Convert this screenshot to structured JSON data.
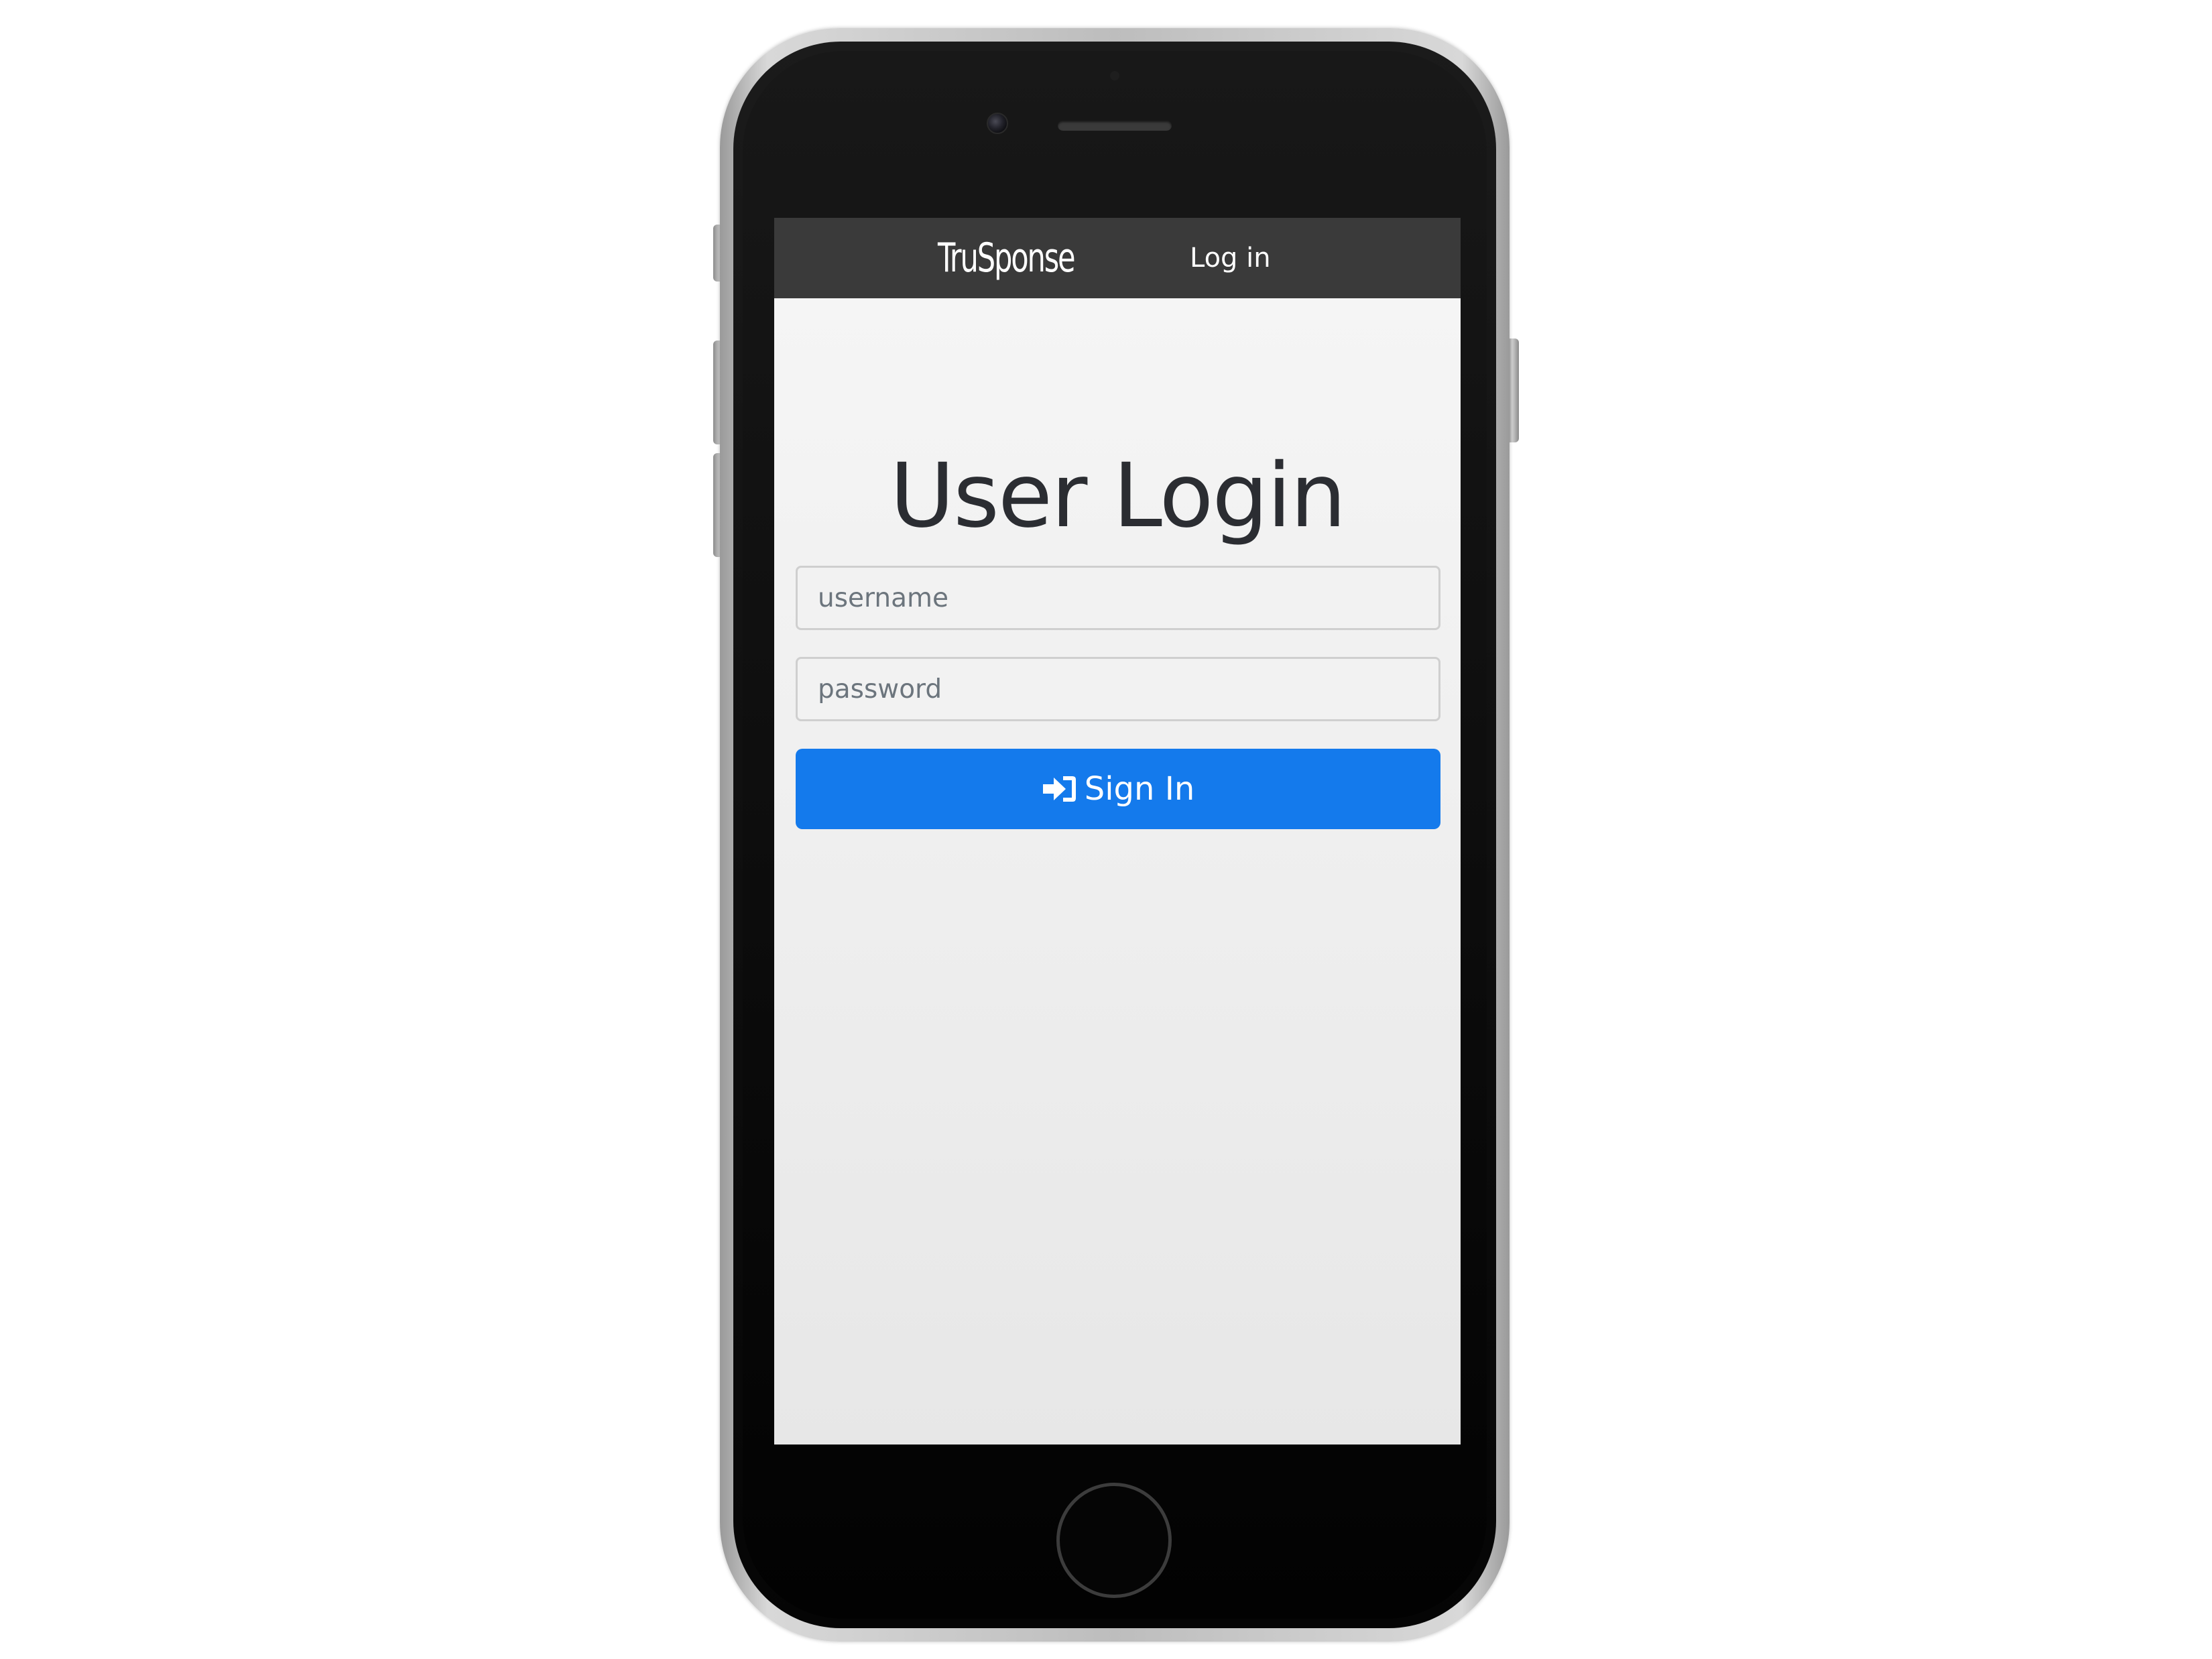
{
  "navbar": {
    "brand": "TruSponse",
    "login_link": "Log in"
  },
  "login_form": {
    "title": "User Login",
    "username_placeholder": "username",
    "password_placeholder": "password",
    "submit_label": "Sign In",
    "submit_icon": "sign-in-icon"
  },
  "colors": {
    "navbar_background": "#3a3a3a",
    "primary_button": "#147aec",
    "page_background": "#f3f3f3",
    "title_text": "#2b2d32"
  }
}
